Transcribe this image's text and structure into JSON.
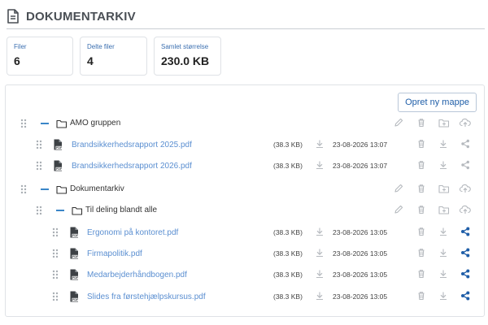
{
  "header": {
    "title": "DOKUMENTARKIV",
    "icon": "document-icon"
  },
  "stats": [
    {
      "label": "Filer",
      "value": "6"
    },
    {
      "label": "Delte filer",
      "value": "4"
    },
    {
      "label": "Samlet størrelse",
      "value": "230.0 KB"
    }
  ],
  "toolbar": {
    "new_folder_label": "Opret ny mappe"
  },
  "tree": {
    "folder_amo": {
      "name": "AMO gruppen"
    },
    "amo_files": [
      {
        "name": "Brandsikkerhedsrapport 2025.pdf",
        "size": "(38.3 KB)",
        "date": "23-08-2026 13:07"
      },
      {
        "name": "Brandsikkerhedsrapport 2026.pdf",
        "size": "(38.3 KB)",
        "date": "23-08-2026 13:07"
      }
    ],
    "folder_dok": {
      "name": "Dokumentarkiv"
    },
    "folder_deling": {
      "name": "Til deling blandt alle"
    },
    "deling_files": [
      {
        "name": "Ergonomi på kontoret.pdf",
        "size": "(38.3 KB)",
        "date": "23-08-2026 13:05"
      },
      {
        "name": "Firmapolitik.pdf",
        "size": "(38.3 KB)",
        "date": "23-08-2026 13:05"
      },
      {
        "name": "Medarbejderhåndbogen.pdf",
        "size": "(38.3 KB)",
        "date": "23-08-2026 13:05"
      },
      {
        "name": "Slides fra førstehjælpskursus.pdf",
        "size": "(38.3 KB)",
        "date": "23-08-2026 13:05"
      }
    ]
  },
  "colors": {
    "accent": "#1f5ea8",
    "link": "#5b8fd1",
    "shared": "#1f5ea8",
    "icon_gray": "#b5b9be"
  }
}
